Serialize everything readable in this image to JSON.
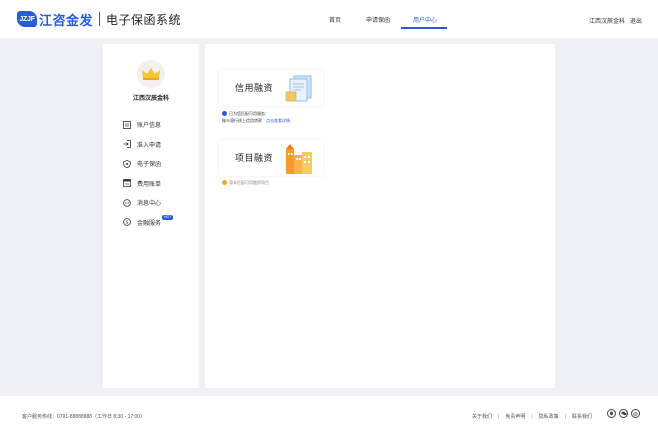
{
  "header": {
    "logo_badge": "JZJF",
    "logo_text": "江咨金发",
    "system_title": "电子保函系统",
    "nav": [
      {
        "label": "首页"
      },
      {
        "label": "申请保函"
      },
      {
        "label": "用户中心"
      }
    ],
    "active_nav": "用户中心",
    "username": "江西汉辰金科",
    "logout": "退出",
    "accent_color": "#2a5bd7"
  },
  "sidebar": {
    "avatar_icon": "crown-icon",
    "username": "江西汉辰金科",
    "items": [
      {
        "label": "账户信息",
        "icon": "account-icon"
      },
      {
        "label": "准入申请",
        "icon": "login-icon"
      },
      {
        "label": "电子保函",
        "icon": "shield-icon"
      },
      {
        "label": "费用账单",
        "icon": "bill-icon"
      },
      {
        "label": "消息中心",
        "icon": "message-icon"
      },
      {
        "label": "金融服务",
        "icon": "finance-icon",
        "badge": "HOT"
      }
    ]
  },
  "main": {
    "cards": [
      {
        "title": "信用融资",
        "tip_line1": "已为您匹配可用服务：",
        "tip_line2": "微众银行线上信用贷款",
        "tip_link": "点击查看详情"
      },
      {
        "title": "项目融资",
        "tip": "暂未匹配可用融资项目"
      }
    ]
  },
  "footer": {
    "hotline": "客户服务热线：0791-88888888（工作日 8:30 - 17:00）",
    "links": [
      "关于我们",
      "免责声明",
      "隐私政策",
      "联系我们"
    ]
  }
}
